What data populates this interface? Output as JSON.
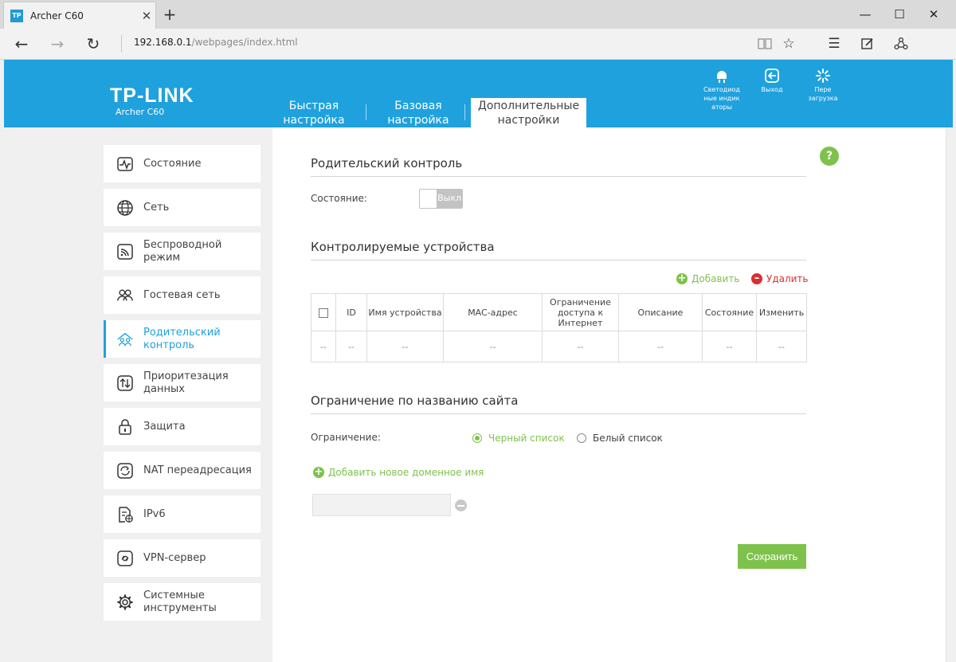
{
  "browser": {
    "tab_favicon": "TP",
    "tab_title": "Archer C60",
    "url_host": "192.168.0.1",
    "url_path": "/webpages/index.html"
  },
  "header": {
    "logo": "TP-LINK",
    "model": "Archer C60",
    "tabs": [
      {
        "line1": "Быстрая",
        "line2": "настройка"
      },
      {
        "line1": "Базовая",
        "line2": "настройка"
      },
      {
        "line1": "Дополнительные",
        "line2": "настройки"
      }
    ],
    "icons": [
      {
        "name": "led-icon",
        "line1": "Светодиод",
        "line2": "ные индик",
        "line3": "аторы"
      },
      {
        "name": "logout-icon",
        "line1": "Выход",
        "line2": "",
        "line3": ""
      },
      {
        "name": "reboot-icon",
        "line1": "Пере",
        "line2": "загрузка",
        "line3": ""
      }
    ]
  },
  "sidebar": {
    "items": [
      {
        "line1": "Состояние",
        "line2": ""
      },
      {
        "line1": "Сеть",
        "line2": ""
      },
      {
        "line1": "Беспроводной",
        "line2": "режим"
      },
      {
        "line1": "Гостевая сеть",
        "line2": ""
      },
      {
        "line1": "Родительский",
        "line2": "контроль"
      },
      {
        "line1": "Приоритезация",
        "line2": "данных"
      },
      {
        "line1": "Защита",
        "line2": ""
      },
      {
        "line1": "NAT переадресация",
        "line2": ""
      },
      {
        "line1": "IPv6",
        "line2": ""
      },
      {
        "line1": "VPN-сервер",
        "line2": ""
      },
      {
        "line1": "Системные",
        "line2": "инструменты"
      }
    ]
  },
  "main": {
    "help": "?",
    "parental": {
      "title": "Родительский контроль",
      "status_label": "Состояние:",
      "toggle_label": "Выкл"
    },
    "devices": {
      "title": "Контролируемые устройства",
      "add": "Добавить",
      "remove": "Удалить",
      "columns": {
        "id": "ID",
        "name": "Имя устройства",
        "mac": "MAC-адрес",
        "limit_1": "Ограничение",
        "limit_2": "доступа к",
        "limit_3": "Интернет",
        "desc": "Описание",
        "status": "Состояние",
        "edit": "Изменить"
      },
      "row": [
        "--",
        "--",
        "--",
        "--",
        "--",
        "--",
        "--",
        "--"
      ]
    },
    "site": {
      "title": "Ограничение по названию сайта",
      "limit_label": "Ограничение:",
      "blacklist": "Черный список",
      "whitelist": "Белый список",
      "add_domain": "Добавить новое доменное имя",
      "domain_value": ""
    },
    "save": "Сохранить"
  },
  "colors": {
    "brand_blue": "#1fa1de",
    "accent_green": "#7ec24c",
    "danger_red": "#d9302f"
  }
}
